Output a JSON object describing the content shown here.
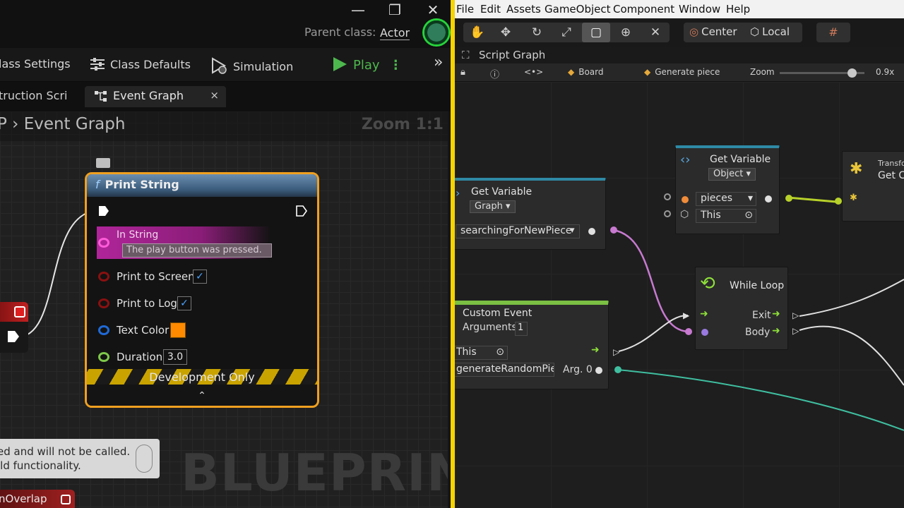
{
  "unreal": {
    "window_controls": {
      "minimize": "—",
      "maximize": "❐",
      "close": "✕"
    },
    "parent_class_label": "Parent class:",
    "parent_class_value": "Actor",
    "toolbar": {
      "class_settings": "lass Settings",
      "class_defaults": "Class Defaults",
      "simulation": "Simulation",
      "play": "Play",
      "more": "⋮",
      "overflow": "»"
    },
    "tabs": {
      "construction": "truction Scri",
      "event_graph": "Event Graph",
      "close": "×"
    },
    "breadcrumb": "P  ›  Event Graph",
    "zoom": "Zoom 1:1",
    "watermark": "BLUEPRINT",
    "print_string": {
      "title": "Print String",
      "fn_symbol": "f",
      "in_string_label": "In String",
      "in_string_value": "The play button was pressed.",
      "print_to_screen": "Print to Screen",
      "print_to_log": "Print to Log",
      "text_color": "Text Color",
      "duration": "Duration",
      "duration_value": "3.0",
      "check": "✓",
      "development_only": "Development Only",
      "collapse": "⌃"
    },
    "warning_note": {
      "line1": "ed and will not be called.",
      "line2": "ild functionality."
    },
    "overlap_node": "nOverlap"
  },
  "unity": {
    "menu": [
      "File",
      "Edit",
      "Assets",
      "GameObject",
      "Component",
      "Window",
      "Help"
    ],
    "pivot": {
      "center": "Center",
      "local": "Local"
    },
    "script_graph": "Script Graph",
    "graph_bar": {
      "board": "Board",
      "generate_piece": "Generate piece",
      "zoom_label": "Zoom",
      "zoom_value": "0.9x",
      "zoom_level": 0.85
    },
    "get_variable_1": {
      "title": "Get Variable",
      "kind": "Graph",
      "field": "searchingForNewPiece"
    },
    "get_variable_2": {
      "title": "Get Variable",
      "kind": "Object",
      "name": "pieces",
      "target": "This"
    },
    "transform_node": {
      "line1": "Transfo",
      "line2": "Get C"
    },
    "while_loop": {
      "title": "While Loop",
      "exit": "Exit",
      "body": "Body"
    },
    "custom_event": {
      "title": "Custom Event",
      "arguments_label": "Arguments",
      "arguments_value": "1",
      "target": "This",
      "name": "generateRandomPiece",
      "arg0": "Arg. 0"
    },
    "colors": {
      "pink_wire": "#c77ad0",
      "teal_wire": "#3fbfa0",
      "yellow_wire": "#b8d12a",
      "exec_green": "#8ee03a"
    }
  }
}
